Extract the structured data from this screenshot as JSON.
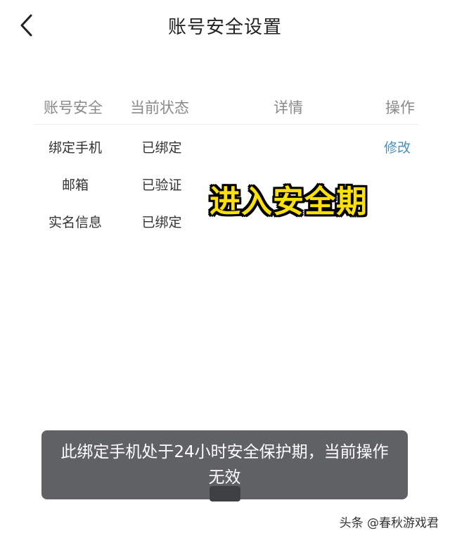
{
  "header": {
    "title": "账号安全设置",
    "back_icon": "chevron-left-icon"
  },
  "table": {
    "columns": [
      "账号安全",
      "当前状态",
      "详情",
      "操作"
    ],
    "rows": [
      {
        "item": "绑定手机",
        "status": "已绑定",
        "detail": "",
        "action": "修改"
      },
      {
        "item": "邮箱",
        "status": "已验证",
        "detail": "",
        "action": ""
      },
      {
        "item": "实名信息",
        "status": "已绑定",
        "detail": "",
        "action": ""
      }
    ]
  },
  "overlay": {
    "caption": "进入安全期"
  },
  "toast": {
    "message": "此绑定手机处于24小时安全保护期，当前操作无效"
  },
  "watermark": {
    "text": "头条 @春秋游戏君"
  },
  "colors": {
    "link": "#4a90b8",
    "caption": "#ffe100",
    "toast_bg": "#5f6164"
  }
}
